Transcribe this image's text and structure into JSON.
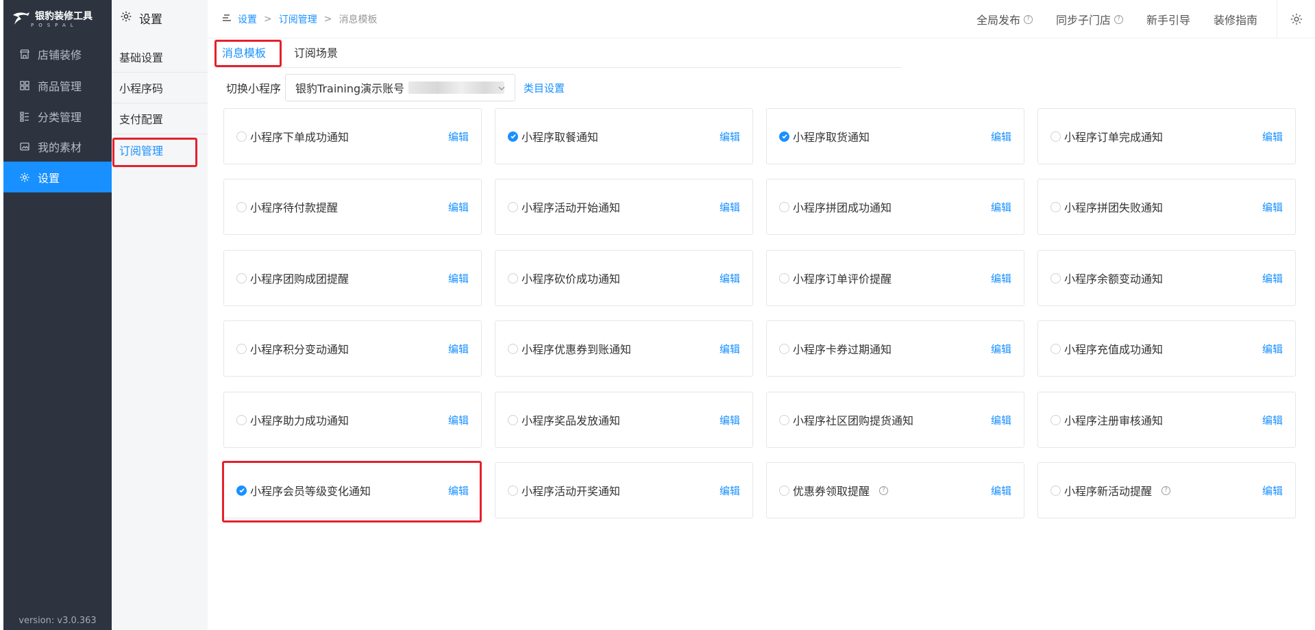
{
  "app": {
    "logo_title": "银豹装修工具",
    "logo_sub": "POSPAL",
    "version": "version: v3.0.363"
  },
  "nav": {
    "items": [
      {
        "label": "店铺装修",
        "icon": "store-icon"
      },
      {
        "label": "商品管理",
        "icon": "grid-icon"
      },
      {
        "label": "分类管理",
        "icon": "list-icon"
      },
      {
        "label": "我的素材",
        "icon": "image-icon"
      },
      {
        "label": "设置",
        "icon": "gear-icon",
        "active": true
      }
    ]
  },
  "subnav": {
    "title": "设置",
    "items": [
      {
        "label": "基础设置"
      },
      {
        "label": "小程序码"
      },
      {
        "label": "支付配置"
      },
      {
        "label": "订阅管理",
        "active": true
      }
    ]
  },
  "breadcrumb": {
    "items": [
      "设置",
      "订阅管理",
      "消息模板"
    ],
    "separator": ">"
  },
  "header": {
    "global_publish": "全局发布",
    "sync_stores": "同步子门店",
    "guide": "新手引导",
    "decor_guide": "装修指南"
  },
  "tabs": [
    {
      "label": "消息模板",
      "active": true
    },
    {
      "label": "订阅场景"
    }
  ],
  "selector": {
    "label": "切换小程序",
    "value": "银豹Training演示账号",
    "category_link": "类目设置"
  },
  "edit_label": "编辑",
  "colors": {
    "accent": "#1890ff",
    "nav_bg": "#2d3440",
    "highlight": "#e5202c"
  },
  "cards": [
    {
      "label": "小程序下单成功通知",
      "checked": false
    },
    {
      "label": "小程序取餐通知",
      "checked": true
    },
    {
      "label": "小程序取货通知",
      "checked": true
    },
    {
      "label": "小程序订单完成通知",
      "checked": false
    },
    {
      "label": "小程序待付款提醒",
      "checked": false
    },
    {
      "label": "小程序活动开始通知",
      "checked": false
    },
    {
      "label": "小程序拼团成功通知",
      "checked": false
    },
    {
      "label": "小程序拼团失败通知",
      "checked": false
    },
    {
      "label": "小程序团购成团提醒",
      "checked": false
    },
    {
      "label": "小程序砍价成功通知",
      "checked": false
    },
    {
      "label": "小程序订单评价提醒",
      "checked": false
    },
    {
      "label": "小程序余额变动通知",
      "checked": false
    },
    {
      "label": "小程序积分变动通知",
      "checked": false
    },
    {
      "label": "小程序优惠券到账通知",
      "checked": false
    },
    {
      "label": "小程序卡券过期通知",
      "checked": false
    },
    {
      "label": "小程序充值成功通知",
      "checked": false
    },
    {
      "label": "小程序助力成功通知",
      "checked": false
    },
    {
      "label": "小程序奖品发放通知",
      "checked": false
    },
    {
      "label": "小程序社区团购提货通知",
      "checked": false
    },
    {
      "label": "小程序注册审核通知",
      "checked": false
    },
    {
      "label": "小程序会员等级变化通知",
      "checked": true
    },
    {
      "label": "小程序活动开奖通知",
      "checked": false
    },
    {
      "label": "优惠券领取提醒",
      "checked": false,
      "help": true
    },
    {
      "label": "小程序新活动提醒",
      "checked": false,
      "help": true
    }
  ]
}
